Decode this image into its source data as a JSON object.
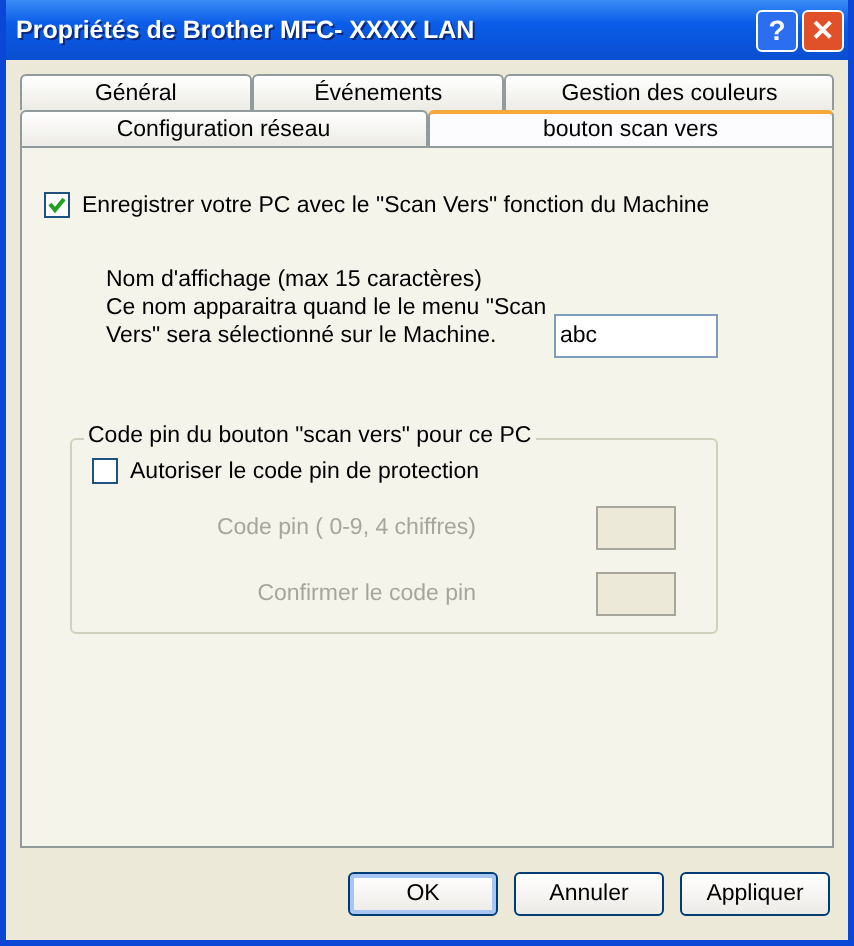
{
  "window": {
    "title": "Propriétés de Brother MFC- XXXX LAN"
  },
  "title_buttons": [
    {
      "kind": "help",
      "label": "?"
    },
    {
      "kind": "close",
      "label": "✕"
    }
  ],
  "tab_rows": [
    [
      {
        "label": "Général",
        "selected": false
      },
      {
        "label": "Événements",
        "selected": false
      },
      {
        "label": "Gestion des couleurs",
        "selected": false
      }
    ],
    [
      {
        "label": "Configuration réseau",
        "selected": false
      },
      {
        "label": "bouton scan vers",
        "selected": true
      }
    ]
  ],
  "register": {
    "label": "Enregistrer votre PC avec le \"Scan Vers\" fonction du Machine",
    "checked": true
  },
  "display_name": {
    "lines": [
      "Nom d'affichage (max 15 caractères)",
      "Ce nom apparaitra quand le le menu \"Scan",
      "Vers\" sera sélectionné sur le Machine."
    ],
    "value": "abc"
  },
  "pin_group": {
    "title": "Code pin du bouton \"scan vers\" pour ce PC",
    "protect": {
      "label": "Autoriser le code pin de protection",
      "checked": false
    },
    "fields": [
      {
        "label": "Code pin ( 0-9, 4 chiffres)",
        "disabled": true
      },
      {
        "label": "Confirmer le code pin",
        "disabled": true
      }
    ]
  },
  "buttons": [
    {
      "label": "OK",
      "default": true
    },
    {
      "label": "Annuler",
      "default": false
    },
    {
      "label": "Appliquer",
      "default": false
    }
  ]
}
